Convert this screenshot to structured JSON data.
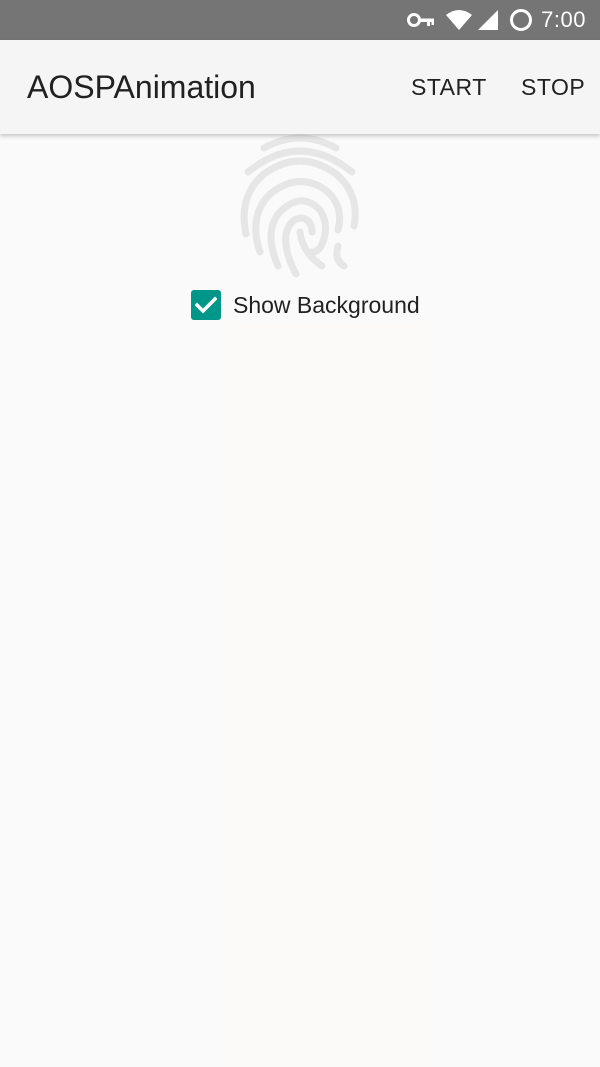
{
  "status_bar": {
    "time": "7:00",
    "icons": [
      "vpn-key-icon",
      "wifi-icon",
      "signal-icon",
      "battery-circle-icon"
    ]
  },
  "app_bar": {
    "title": "AOSPAnimation",
    "actions": {
      "start": "START",
      "stop": "STOP"
    }
  },
  "content": {
    "fingerprint_icon": "fingerprint-icon",
    "checkbox": {
      "label": "Show Background",
      "checked": true
    }
  },
  "colors": {
    "status_bar": "#757575",
    "app_bar": "#f5f5f5",
    "accent": "#009688",
    "background": "#fafafa",
    "text": "#212121"
  }
}
